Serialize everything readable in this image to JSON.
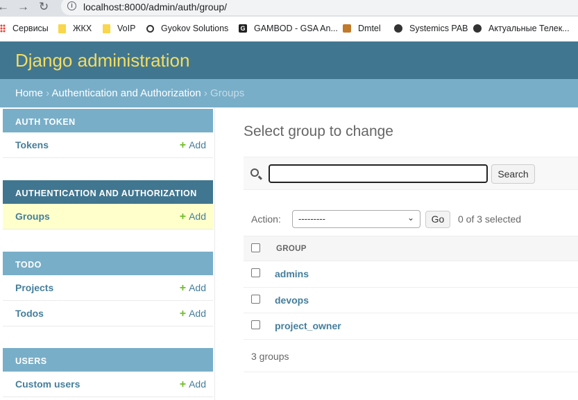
{
  "browser": {
    "url": "localhost:8000/admin/auth/group/",
    "bookmarks": [
      "Сервисы",
      "ЖКХ",
      "VoIP",
      "Gyokov Solutions",
      "GAMBOD - GSA An...",
      "Dmtel",
      "Systemics PAB",
      "Актуальные Телек..."
    ]
  },
  "header": {
    "brand": "Django administration"
  },
  "breadcrumbs": {
    "home": "Home",
    "section": "Authentication and Authorization",
    "current": "Groups",
    "sep": " › "
  },
  "sidebar": {
    "add_label": "Add",
    "modules": [
      {
        "caption": "Auth Token",
        "models": [
          "Tokens"
        ]
      },
      {
        "caption": "Authentication and Authorization",
        "models": [
          "Groups"
        ]
      },
      {
        "caption": "Todo",
        "models": [
          "Projects",
          "Todos"
        ]
      },
      {
        "caption": "Users",
        "models": [
          "Custom users"
        ]
      }
    ]
  },
  "main": {
    "title": "Select group to change",
    "search_button": "Search",
    "action_label": "Action:",
    "action_value": "---------",
    "go_button": "Go",
    "selected": "0 of 3 selected",
    "column_header": "GROUP",
    "rows": [
      "admins",
      "devops",
      "project_owner"
    ],
    "paginator": "3 groups"
  }
}
